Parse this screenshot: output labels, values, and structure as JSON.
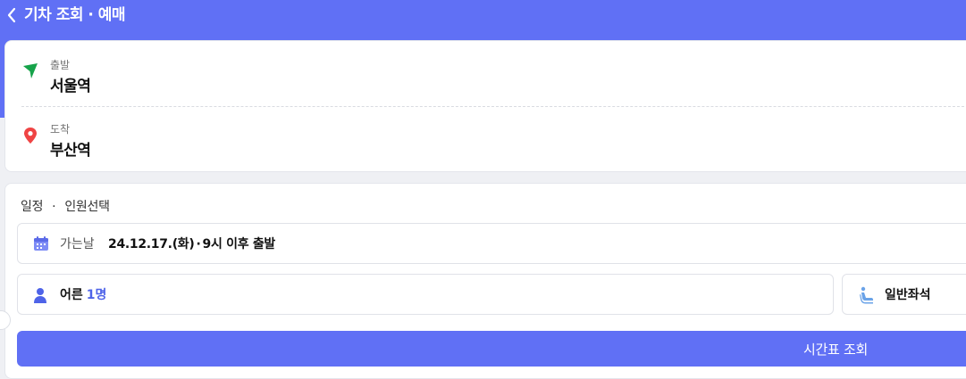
{
  "header": {
    "title": "기차 조회 · 예매",
    "back_icon": "chevron-left-icon",
    "background_color": "#6070f5"
  },
  "stations": {
    "departure": {
      "label": "출발",
      "value": "서울역",
      "icon": "navigation-arrow-icon",
      "icon_color": "#16a34a"
    },
    "arrival": {
      "label": "도착",
      "value": "부산역",
      "icon": "map-pin-icon",
      "icon_color": "#ef4444"
    }
  },
  "schedule": {
    "section_title": "일정",
    "section_dot": "·",
    "section_subtitle": "인원선택",
    "date": {
      "icon": "calendar-icon",
      "label": "가는날",
      "value_date": "24.12.17.(화)",
      "value_sep": "·",
      "value_time": "9시 이후 출발"
    },
    "passengers": {
      "icon": "person-icon",
      "label": "어른",
      "count": "1명"
    },
    "seat": {
      "icon": "seat-icon",
      "value": "일반좌석"
    },
    "search_button": "시간표 조회"
  },
  "colors": {
    "accent": "#6070f5",
    "count_accent": "#4e63e8"
  }
}
